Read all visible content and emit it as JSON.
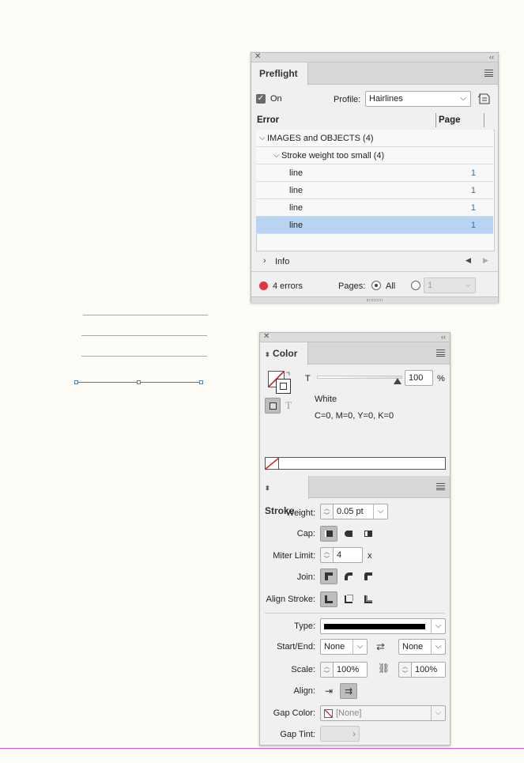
{
  "preflight": {
    "title": "Preflight",
    "on_label": "On",
    "profile_label": "Profile:",
    "profile_value": "Hairlines",
    "col_error": "Error",
    "col_page": "Page",
    "group": "IMAGES and OBJECTS (4)",
    "subgroup": "Stroke weight too small (4)",
    "rows": [
      {
        "label": "line",
        "page": "1"
      },
      {
        "label": "line",
        "page": "1"
      },
      {
        "label": "line",
        "page": "1"
      },
      {
        "label": "line",
        "page": "1"
      }
    ],
    "info_label": "Info",
    "errors_label": "4 errors",
    "pages_label": "Pages:",
    "all_label": "All",
    "page_field": "1",
    "status_color": "#e0353d"
  },
  "color": {
    "title": "Color",
    "t_label": "T",
    "tint_value": "100",
    "percent": "%",
    "swatch_name": "White",
    "cmyk": "C=0, M=0, Y=0, K=0",
    "text_t": "T"
  },
  "stroke": {
    "title": "Stroke",
    "weight_label": "Weight:",
    "weight_value": "0.05 pt",
    "cap_label": "Cap:",
    "miter_label": "Miter Limit:",
    "miter_value": "4",
    "miter_x": "x",
    "join_label": "Join:",
    "align_stroke_label": "Align Stroke:",
    "type_label": "Type:",
    "start_end_label": "Start/End:",
    "start_value": "None",
    "end_value": "None",
    "scale_label": "Scale:",
    "scale_start": "100%",
    "scale_end": "100%",
    "align_label": "Align:",
    "gap_color_label": "Gap Color:",
    "gap_color_value": "[None]",
    "gap_tint_label": "Gap Tint:"
  }
}
